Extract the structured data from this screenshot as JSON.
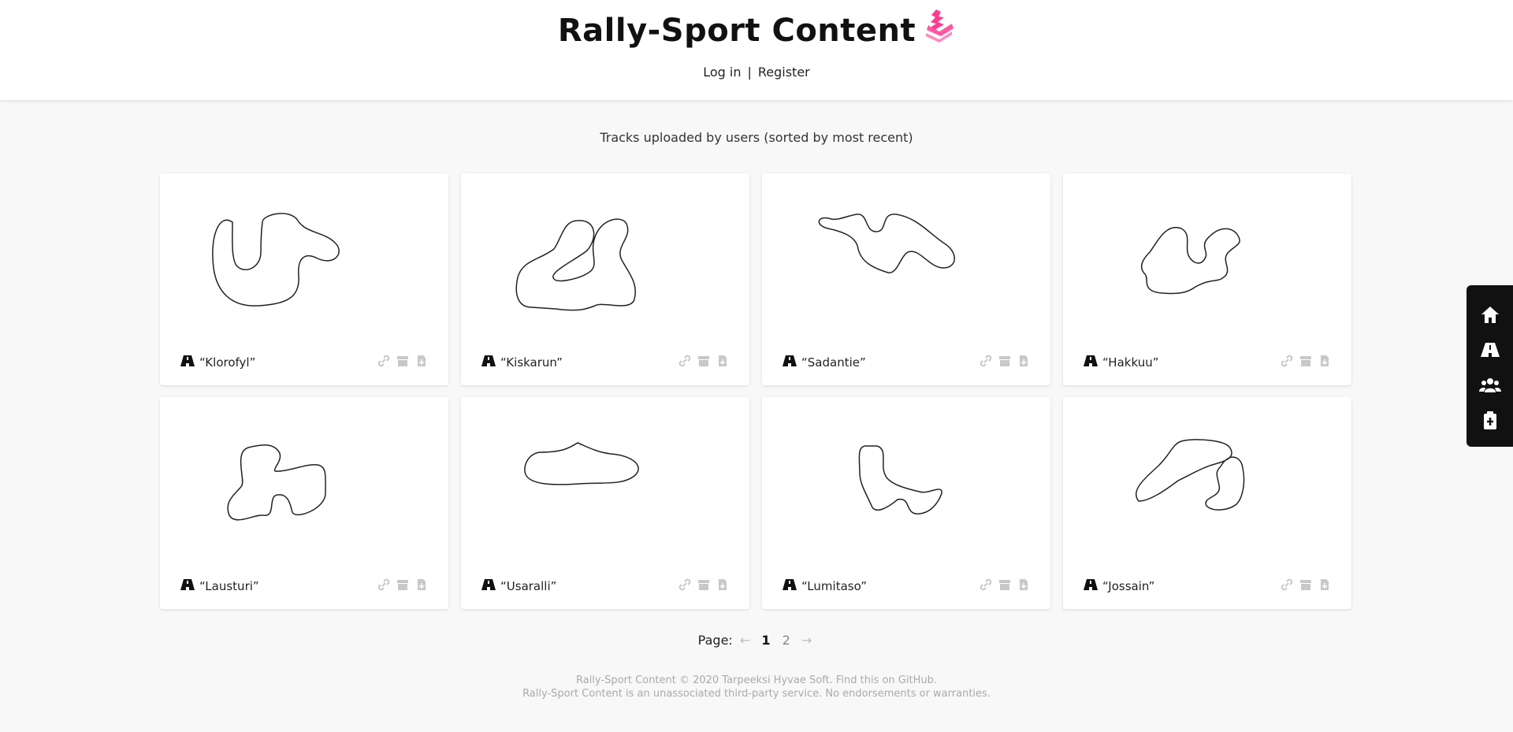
{
  "header": {
    "title": "Rally-Sport Content",
    "login_label": "Log in",
    "separator": "|",
    "register_label": "Register"
  },
  "main": {
    "subtitle": "Tracks uploaded by users (sorted by most recent)",
    "tracks": [
      {
        "name": "“Klorofyl”"
      },
      {
        "name": "“Kiskarun”"
      },
      {
        "name": "“Sadantie”"
      },
      {
        "name": "“Hakkuu”"
      },
      {
        "name": "“Lausturi”"
      },
      {
        "name": "“Usaralli”"
      },
      {
        "name": "“Lumitaso”"
      },
      {
        "name": "“Jossain”"
      }
    ],
    "card_actions": [
      "link-icon",
      "package-icon",
      "download-icon"
    ]
  },
  "pagination": {
    "label": "Page:",
    "prev_arrow": "←",
    "current_page": "1",
    "next_page": "2",
    "next_arrow": "→"
  },
  "footer": {
    "line1_prefix": "Rally-Sport Content © 2020 Tarpeeksi Hyvae Soft. Find this on ",
    "github_link": "GitHub",
    "line1_suffix": ".",
    "line2": "Rally-Sport Content is an unassociated third-party service. No endorsements or warranties."
  },
  "sidebar": {
    "icons": [
      "home-icon",
      "road-icon",
      "users-icon",
      "upload-icon"
    ]
  },
  "colors": {
    "brand_accent": "#ff3b8d",
    "sidebar_bg": "#111111",
    "icon_muted": "#c8c8c8"
  }
}
